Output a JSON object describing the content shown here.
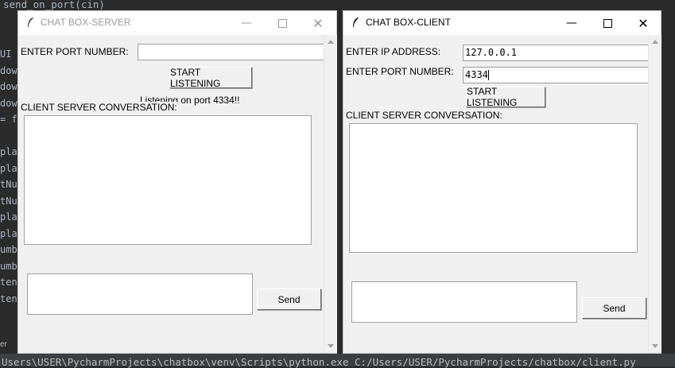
{
  "background": {
    "top_code": "send_on_port(cin)",
    "left_fragments": [
      "UI",
      "dow",
      "dow",
      "dow",
      "= f",
      "",
      "play",
      "play",
      "tNum",
      "tNum",
      "play",
      "play",
      "umbe",
      "umbe",
      "tenB",
      "tenB"
    ],
    "bottom_tab": "er",
    "terminal_line": "Users\\USER\\PycharmProjects\\chatbox\\venv\\Scripts\\python.exe C:/Users/USER/PycharmProjects/chatbox/client.py"
  },
  "server": {
    "title": "CHAT BOX-SERVER",
    "port_label": "ENTER PORT NUMBER:",
    "port_value": "",
    "start_button": "START LISTENING",
    "status_text": "Listening on port 4334!!",
    "conversation_label": "CLIENT SERVER CONVERSATION:",
    "send_button": "Send"
  },
  "client": {
    "title": "CHAT BOX-CLIENT",
    "ip_label": "ENTER IP ADDRESS:",
    "ip_value": "127.0.0.1",
    "port_label": "ENTER PORT NUMBER:",
    "port_value": "4334",
    "start_button": "START LISTENING",
    "conversation_label": "CLIENT SERVER CONVERSATION:",
    "send_button": "Send"
  },
  "icons": {
    "window_icon": "feather-icon",
    "minimize": "minimize-icon",
    "maximize": "maximize-icon",
    "close": "close-icon"
  },
  "colors": {
    "window_bg": "#f0f0f0",
    "titlebar_active": "#ffffff",
    "editor_bg": "#2b2b2b",
    "inactive_title_text": "#999999"
  }
}
